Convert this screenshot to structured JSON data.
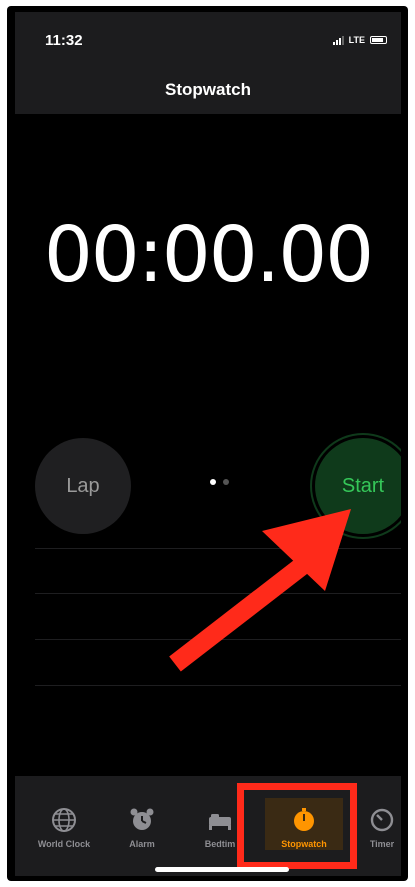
{
  "status_bar": {
    "time": "11:32",
    "network": "LTE"
  },
  "header": {
    "title": "Stopwatch"
  },
  "stopwatch": {
    "display": "00:00.00",
    "lap_label": "Lap",
    "start_label": "Start"
  },
  "page_indicator": {
    "count": 2,
    "active_index": 0
  },
  "tabs": [
    {
      "label": "World Clock",
      "icon": "globe-icon",
      "active": false
    },
    {
      "label": "Alarm",
      "icon": "alarm-clock-icon",
      "active": false
    },
    {
      "label": "Bedtim",
      "icon": "bed-icon",
      "active": false
    },
    {
      "label": "Stopwatch",
      "icon": "stopwatch-icon",
      "active": true
    },
    {
      "label": "Timer",
      "icon": "timer-icon",
      "active": false
    }
  ],
  "colors": {
    "start_text": "#35c759",
    "active_tab": "#ff9500",
    "annotation": "#ff2a1a"
  }
}
